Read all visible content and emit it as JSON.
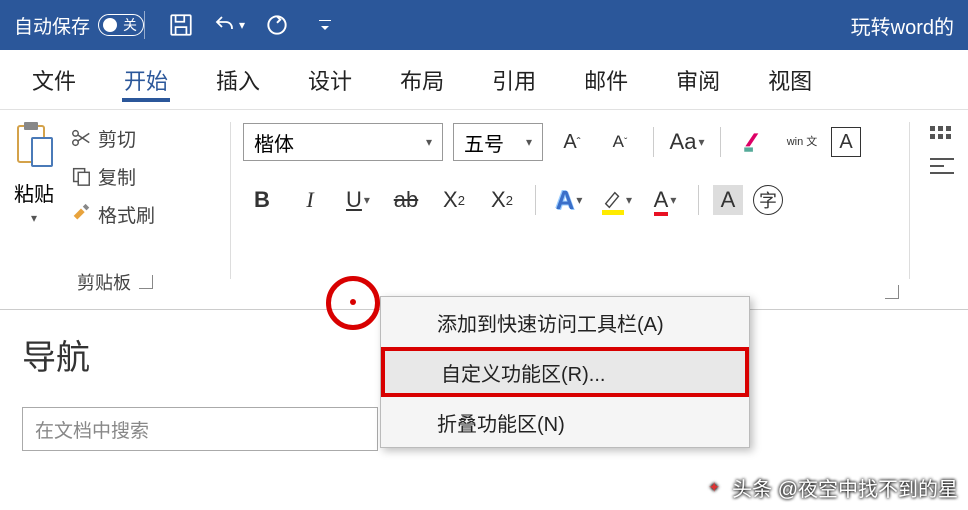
{
  "titlebar": {
    "auto_save": "自动保存",
    "toggle_state": "关",
    "doc_title": "玩转word的"
  },
  "tabs": [
    "文件",
    "开始",
    "插入",
    "设计",
    "布局",
    "引用",
    "邮件",
    "审阅",
    "视图"
  ],
  "active_tab_index": 1,
  "clipboard": {
    "paste": "粘贴",
    "cut": "剪切",
    "copy": "复制",
    "format_painter": "格式刷",
    "group_title": "剪贴板"
  },
  "font": {
    "name": "楷体",
    "size": "五号",
    "aa": "Aa",
    "wen": "win 文",
    "char_box": "A",
    "char_circle": "字"
  },
  "nav": {
    "title": "导航",
    "search_placeholder": "在文档中搜索"
  },
  "context_menu": {
    "add_qat": "添加到快速访问工具栏(A)",
    "customize_ribbon": "自定义功能区(R)...",
    "collapse_ribbon": "折叠功能区(N)"
  },
  "watermark": "头条 @夜空中找不到的星"
}
